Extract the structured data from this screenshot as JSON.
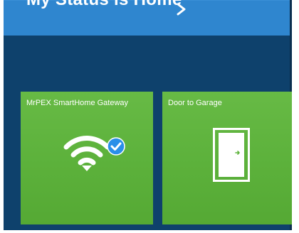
{
  "status": {
    "title": "My Status is Home",
    "chevron_icon": "chevron-right-icon"
  },
  "tiles": [
    {
      "label": "MrPEX SmartHome Gateway",
      "icon": "wifi-icon",
      "badge_icon": "checkmark-badge-icon",
      "state": "connected"
    },
    {
      "label": "Door to Garage",
      "icon": "door-icon"
    }
  ],
  "colors": {
    "header_blue": "#2f86cf",
    "background_navy": "#0e416c",
    "tile_green": "#5fb33e",
    "badge_blue": "#2a8fe8"
  }
}
